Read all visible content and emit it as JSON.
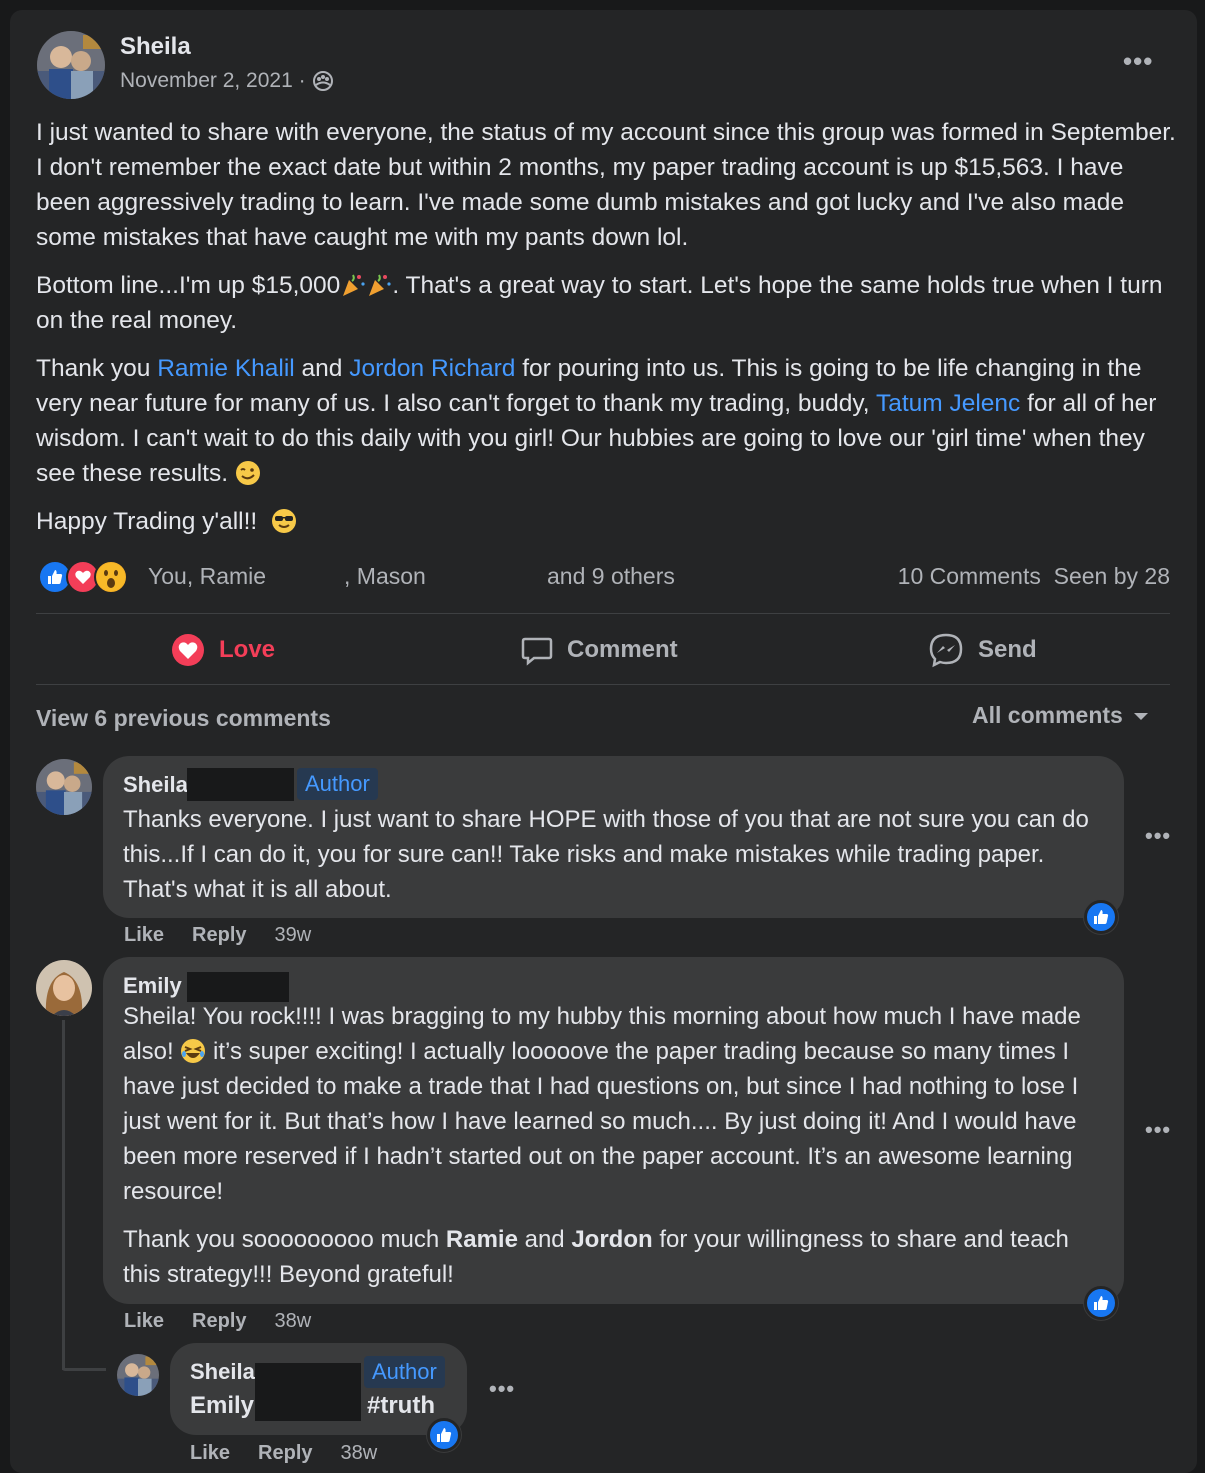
{
  "post": {
    "author": "Sheila",
    "date": "November 2, 2021 ·",
    "more_icon": "more-horizontal-icon",
    "privacy_icon": "group-privacy-icon",
    "paragraphs": {
      "p1": "I just wanted to share with everyone, the status of my account since this group was formed in September.  I don't remember the exact date but within 2 months, my paper trading account is up $15,563.  I have been aggressively trading to learn.  I've made some dumb mistakes and got lucky and I've also made some mistakes that have caught me with my pants down lol.",
      "p2a": "Bottom line...I'm up $15,000",
      "p2b": ".  That's a great way to start.  Let's hope the same holds true when I turn on the real money.",
      "p3a": "Thank you ",
      "p3_link1": "Ramie Khalil",
      "p3b": " and ",
      "p3_link2": "Jordon Richard",
      "p3c": " for pouring into us.  This is going to be life changing in the very near future for many of us.  I also can't forget to thank my trading, buddy, ",
      "p3_link3": "Tatum Jelenc",
      "p3d": " for all of her wisdom.  I can't wait to do this daily with you girl!  Our hubbies are going to love our 'girl time' when they see these results.",
      "p4": "Happy Trading y'all!!"
    }
  },
  "reactions": {
    "names_a": "You, Ramie",
    "names_b": ", Mason",
    "names_c": "and 9 others",
    "comments_count": "10 Comments",
    "seen_by": "Seen by 28"
  },
  "actions": {
    "love": "Love",
    "comment": "Comment",
    "send": "Send"
  },
  "comments_header": {
    "view_previous": "View 6 previous comments",
    "sort": "All comments"
  },
  "comments": [
    {
      "name": "Sheila",
      "badge": "Author",
      "text": "Thanks everyone. I just want to share HOPE with those of you that are not sure you can do this...If I can do it, you for sure can!! Take risks and make mistakes while trading paper. That's what it is all about.",
      "like": "Like",
      "reply": "Reply",
      "time": "39w"
    },
    {
      "name": "Emily",
      "text_p1a": "Sheila! You rock!!!! I was bragging to my hubby this morning about how much I have made also! ",
      "text_p1b": " it’s super exciting! I actually looooove the paper trading because so many times I have just decided to make a trade that I had questions on, but since I had nothing to lose I just went for it. But that’s how I have learned so much.... By just doing it! And I would have been more reserved if I hadn’t started out on the paper account. It’s an awesome learning resource!",
      "text_p2a": "Thank you sooooooooo much ",
      "text_p2_b1": "Ramie",
      "text_p2b": " and ",
      "text_p2_b2": "Jordon",
      "text_p2c": " for your willingness to share and teach this strategy!!! Beyond grateful!",
      "like": "Like",
      "reply": "Reply",
      "time": "38w"
    },
    {
      "name": "Sheila",
      "badge": "Author",
      "mention": "Emily",
      "text": "#truth",
      "like": "Like",
      "reply": "Reply",
      "time": "38w"
    }
  ]
}
